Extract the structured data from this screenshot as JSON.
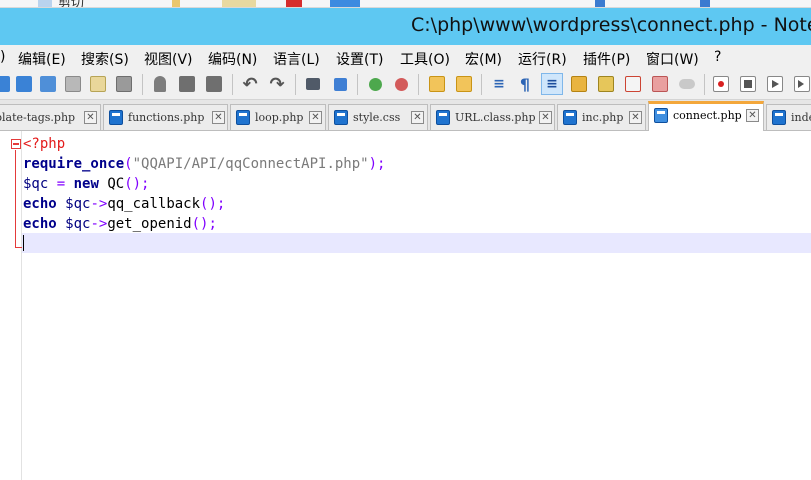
{
  "window": {
    "title": "C:\\php\\www\\wordpress\\connect.php - Note"
  },
  "topstrip": {
    "fragment": "剪切"
  },
  "menu": [
    {
      "label": ")"
    },
    {
      "label": "编辑(E)"
    },
    {
      "label": "搜索(S)"
    },
    {
      "label": "视图(V)"
    },
    {
      "label": "编码(N)"
    },
    {
      "label": "语言(L)"
    },
    {
      "label": "设置(T)"
    },
    {
      "label": "工具(O)"
    },
    {
      "label": "宏(M)"
    },
    {
      "label": "运行(R)"
    },
    {
      "label": "插件(P)"
    },
    {
      "label": "窗口(W)"
    },
    {
      "label": "?"
    }
  ],
  "toolbar": {
    "icons": [
      "new-icon",
      "open-icon",
      "save-icon",
      "save-all-icon",
      "close-icon",
      "close-all-icon",
      "print-icon",
      "cut-icon",
      "copy-icon",
      "paste-icon",
      "undo-icon",
      "redo-icon",
      "find-icon",
      "replace-icon",
      "zoom-in-icon",
      "zoom-out-icon",
      "sync-vertical-icon",
      "sync-horizontal-icon",
      "word-wrap-icon",
      "show-all-chars-icon",
      "indent-guide-icon",
      "user-language-icon",
      "document-map-icon",
      "function-list-icon",
      "folder-workspace-icon",
      "monitoring-icon",
      "record-macro-icon",
      "stop-recording-icon",
      "play-macro-icon"
    ],
    "active": "indent-guide-icon"
  },
  "tabs": [
    {
      "label": "plate-tags.php",
      "active": false
    },
    {
      "label": "functions.php",
      "active": false
    },
    {
      "label": "loop.php",
      "active": false
    },
    {
      "label": "style.css",
      "active": false
    },
    {
      "label": "URL.class.php",
      "active": false
    },
    {
      "label": "inc.php",
      "active": false
    },
    {
      "label": "connect.php",
      "active": true
    },
    {
      "label": "inde",
      "active": false
    }
  ],
  "editor": {
    "lines": [
      [
        {
          "t": "<?php",
          "c": "php"
        }
      ],
      [
        {
          "t": "require_once",
          "c": "kw"
        },
        {
          "t": "(",
          "c": "op"
        },
        {
          "t": "\"QQAPI/API/qqConnectAPI.php\"",
          "c": "str"
        },
        {
          "t": ");",
          "c": "op"
        }
      ],
      [
        {
          "t": "$qc",
          "c": "var"
        },
        {
          "t": " ",
          "c": "fn"
        },
        {
          "t": "=",
          "c": "op"
        },
        {
          "t": " ",
          "c": "fn"
        },
        {
          "t": "new",
          "c": "kw"
        },
        {
          "t": " QC",
          "c": "fn"
        },
        {
          "t": "();",
          "c": "op"
        }
      ],
      [
        {
          "t": "echo",
          "c": "kw"
        },
        {
          "t": " ",
          "c": "fn"
        },
        {
          "t": "$qc",
          "c": "var"
        },
        {
          "t": "->",
          "c": "op"
        },
        {
          "t": "qq_callback",
          "c": "fn"
        },
        {
          "t": "();",
          "c": "op"
        }
      ],
      [
        {
          "t": "echo",
          "c": "kw"
        },
        {
          "t": " ",
          "c": "fn"
        },
        {
          "t": "$qc",
          "c": "var"
        },
        {
          "t": "->",
          "c": "op"
        },
        {
          "t": "get_openid",
          "c": "fn"
        },
        {
          "t": "();",
          "c": "op"
        }
      ],
      []
    ]
  },
  "colors": {
    "titlebar": "#5ec8f2",
    "active_tab_accent": "#f3a73b",
    "current_line": "#e8e8ff",
    "fold_marker": "#e43a3a"
  }
}
